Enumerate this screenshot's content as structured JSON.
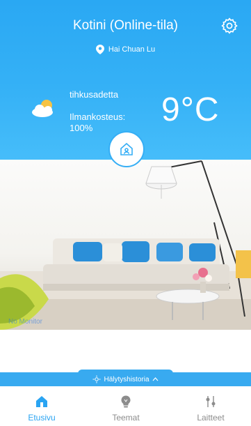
{
  "header": {
    "title": "Kotini (Online-tila)",
    "location": "Hai Chuan Lu"
  },
  "weather": {
    "condition": "tihkusadetta",
    "humidity_label": "Ilmankosteus:",
    "humidity_value": "100%",
    "temperature": "9°C"
  },
  "room": {
    "status_text": "No Monitor"
  },
  "alarm": {
    "label": "Hälytyshistoria"
  },
  "nav": {
    "items": [
      {
        "label": "Etusivu",
        "icon": "home-icon",
        "active": true
      },
      {
        "label": "Teemat",
        "icon": "bulb-icon",
        "active": false
      },
      {
        "label": "Laitteet",
        "icon": "sliders-icon",
        "active": false
      }
    ]
  },
  "colors": {
    "accent": "#2aa4f2",
    "inactive": "#8c8c8c"
  }
}
